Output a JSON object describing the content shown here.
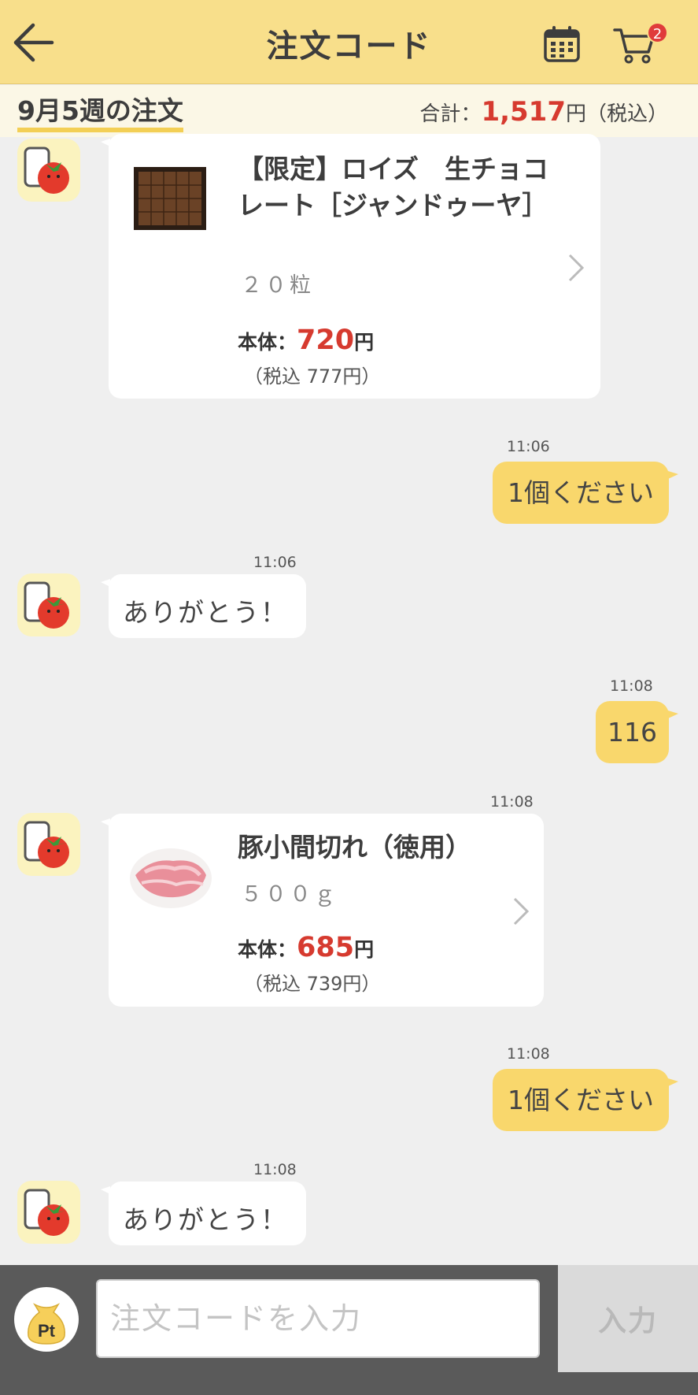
{
  "header": {
    "title": "注文コード",
    "cart_badge": "2"
  },
  "summary": {
    "week": "9月5週の注文",
    "total_prefix": "合計：",
    "total_amount": "1,517",
    "total_suffix": "円（税込）"
  },
  "messages": {
    "product1": {
      "name": "【限定】ロイズ　生チョコレート［ジャンドゥーヤ］",
      "size": "２０粒",
      "price_label": "本体：",
      "price": "720",
      "price_unit": "円",
      "tax": "（税込 777円）"
    },
    "user1": {
      "time": "11:06",
      "text": "1個ください"
    },
    "bot1": {
      "time": "11:06",
      "text": "ありがとう！"
    },
    "user2": {
      "time": "11:08",
      "text": "116"
    },
    "product2": {
      "time": "11:08",
      "name": "豚小間切れ（徳用）",
      "size": "５００ｇ",
      "price_label": "本体：",
      "price": "685",
      "price_unit": "円",
      "tax": "（税込 739円）"
    },
    "user3": {
      "time": "11:08",
      "text": "1個ください"
    },
    "bot2": {
      "time": "11:08",
      "text": "ありがとう！"
    }
  },
  "input": {
    "pt_label": "Pt",
    "placeholder": "注文コードを入力",
    "submit_label": "入力"
  },
  "colors": {
    "header_bg": "#f8df8b",
    "accent_price": "#d63a2f",
    "user_bubble": "#f9d76c",
    "bottom_bar": "#5a5a5a"
  }
}
